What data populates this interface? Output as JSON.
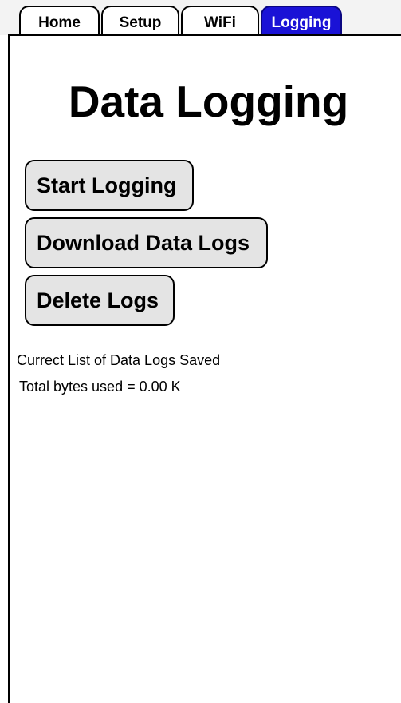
{
  "tabs": [
    {
      "label": "Home",
      "active": false
    },
    {
      "label": "Setup",
      "active": false
    },
    {
      "label": "WiFi",
      "active": false
    },
    {
      "label": "Logging",
      "active": true
    }
  ],
  "colors": {
    "active_tab": "#1a12d6",
    "button_bg": "#e4e4e4",
    "tabbar_bg": "#f3f3f3"
  },
  "main": {
    "title": "Data Logging",
    "buttons": {
      "start": "Start Logging",
      "download": "Download Data Logs",
      "delete": "Delete Logs"
    },
    "info": {
      "list_label": "Currect List of Data Logs Saved",
      "bytes_used": "Total bytes used = 0.00 K"
    }
  }
}
